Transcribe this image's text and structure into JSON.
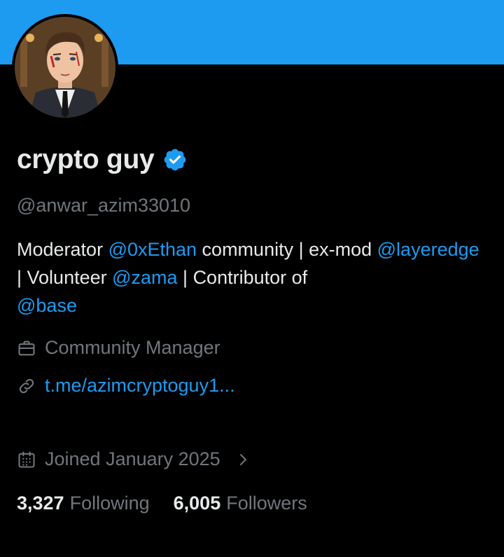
{
  "header": {
    "banner_color": "#1d9bf0"
  },
  "profile": {
    "display_name": "crypto guy",
    "verified_badge": "verified-check-icon",
    "handle": "@anwar_azim33010",
    "bio": [
      {
        "text": "Moderator ",
        "mention": false
      },
      {
        "text": "@0xEthan",
        "mention": true
      },
      {
        "text": " community | ex-mod ",
        "mention": false
      },
      {
        "text": "@layeredge",
        "mention": true
      },
      {
        "text": " | Volunteer ",
        "mention": false
      },
      {
        "text": "@zama",
        "mention": true
      },
      {
        "text": " | Contributor of ",
        "mention": false
      },
      {
        "text": "@base",
        "mention": true
      }
    ],
    "job": {
      "icon": "briefcase-icon",
      "text": "Community Manager"
    },
    "link": {
      "icon": "link-icon",
      "text": "t.me/azimcryptoguy1..."
    },
    "joined": {
      "icon": "calendar-icon",
      "text": "Joined January 2025",
      "chevron": "chevron-right-icon"
    },
    "stats": {
      "following_count": "3,327",
      "following_label": "Following",
      "followers_count": "6,005",
      "followers_label": "Followers"
    }
  },
  "colors": {
    "accent": "#1d9bf0",
    "text": "#e7e9ea",
    "muted": "#71767b",
    "background": "#000000"
  }
}
